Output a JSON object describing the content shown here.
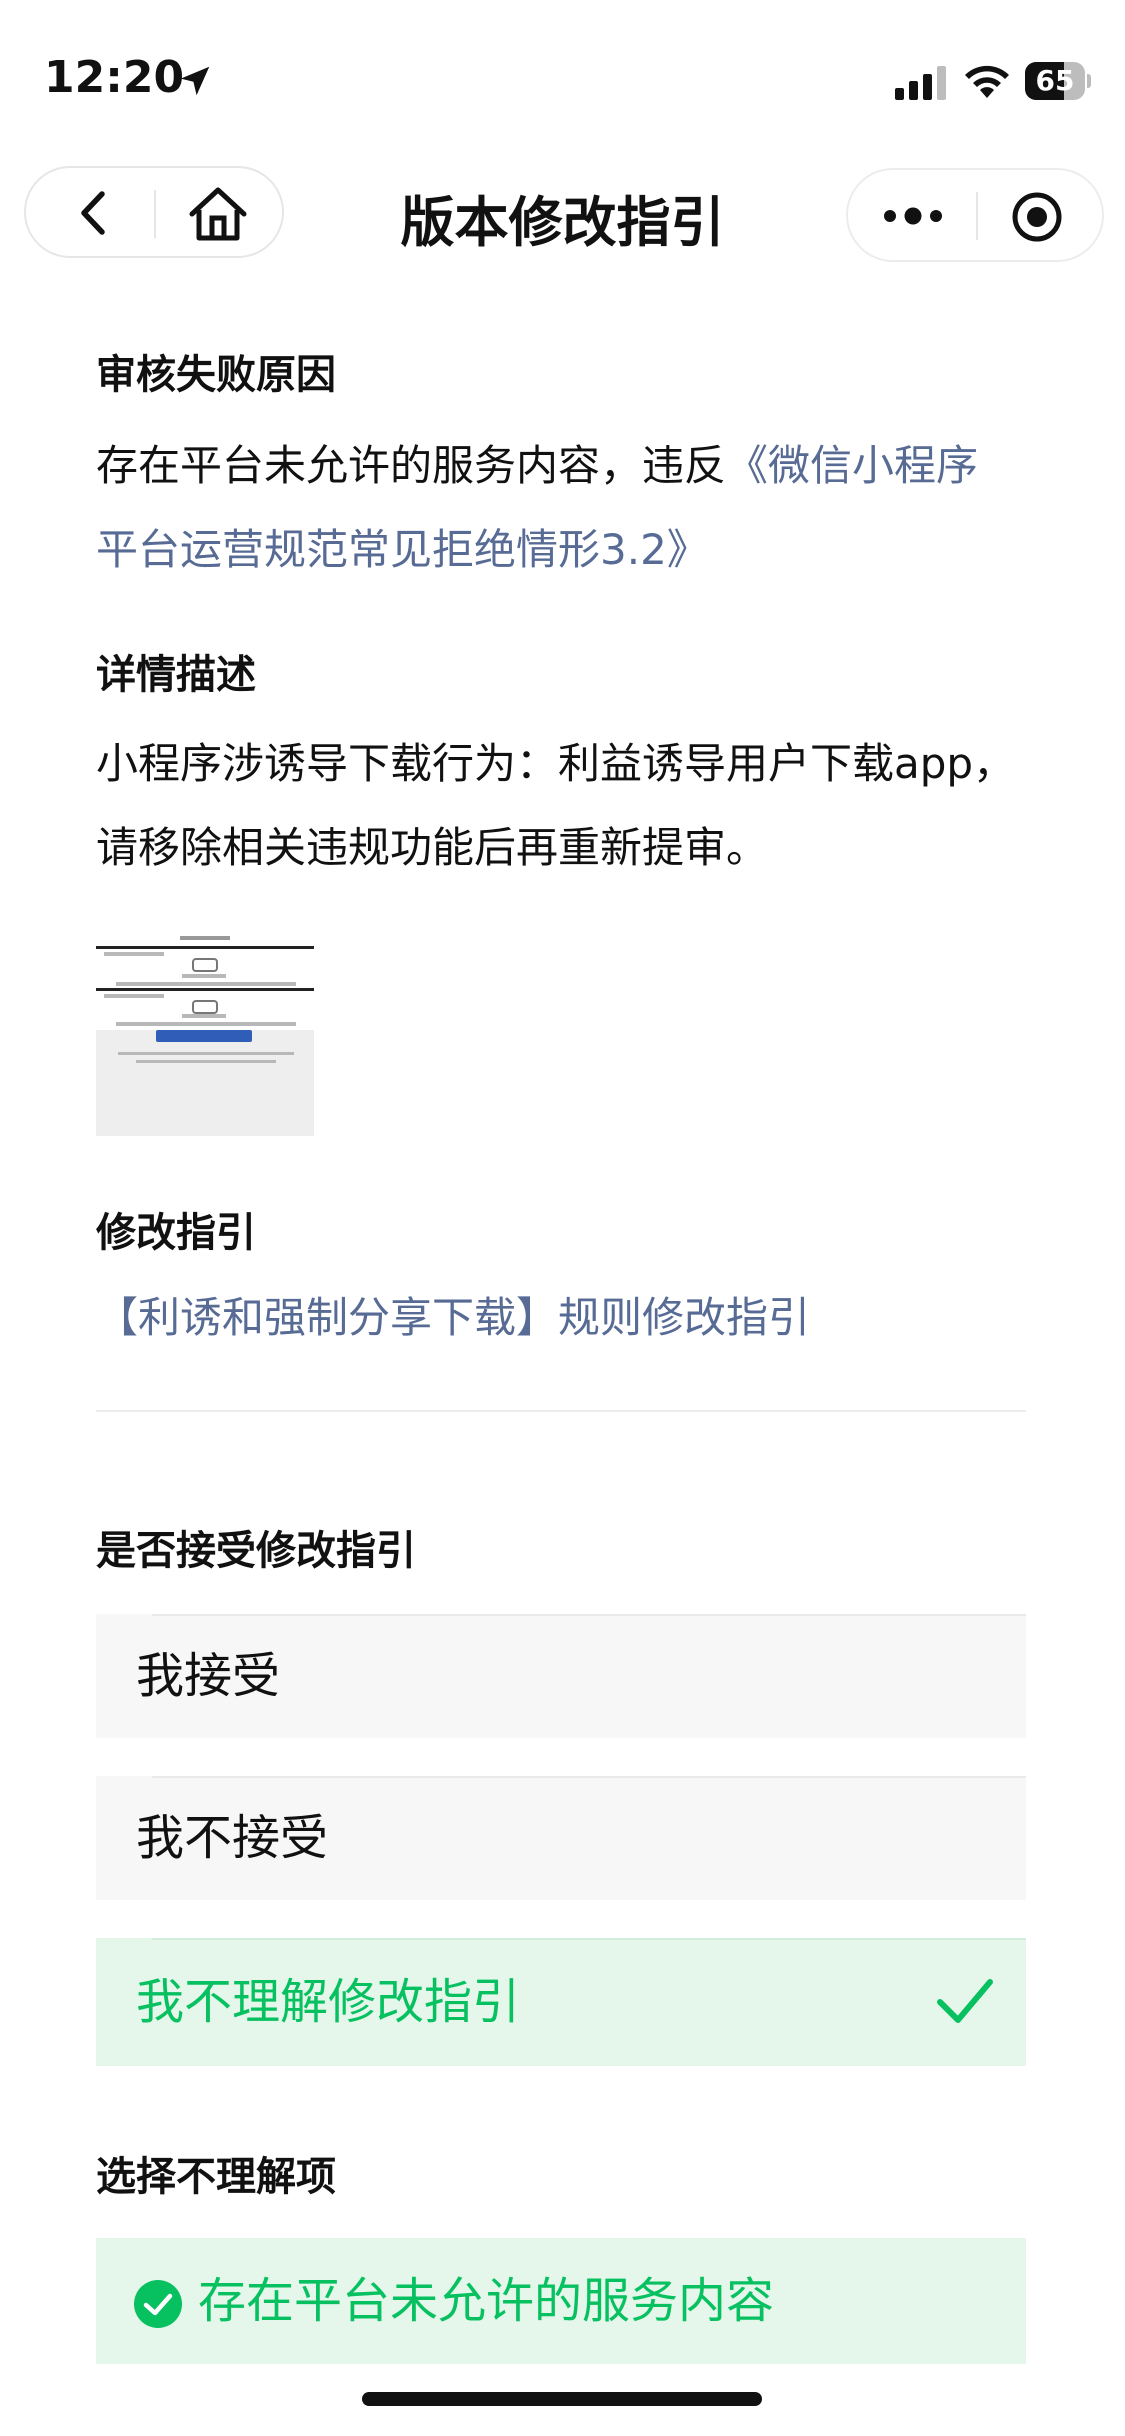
{
  "status_bar": {
    "time": "12:20",
    "battery": "65",
    "battery_level": 0.65,
    "icons": [
      "location-arrow-icon",
      "cellular-signal-icon",
      "wifi-icon",
      "battery-icon"
    ]
  },
  "nav": {
    "title": "版本修改指引",
    "left_icons": [
      "back-icon",
      "home-icon"
    ],
    "right_icons": [
      "more-icon",
      "record-icon"
    ]
  },
  "sections": {
    "reason": {
      "heading": "审核失败原因",
      "text_line1_plain": "存在平台未允许的服务内容，违反",
      "text_line1_link": "《微信小程序",
      "text_line2_link": "平台运营规范常见拒绝情形3.2》"
    },
    "detail": {
      "heading": "详情描述",
      "line1": "小程序涉诱导下载行为：利益诱导用户下载app，",
      "line2": "请移除相关违规功能后再重新提审。"
    },
    "guide": {
      "heading": "修改指引",
      "link": "【利诱和强制分享下载】规则修改指引"
    },
    "accept": {
      "heading": "是否接受修改指引",
      "options": [
        {
          "label": "我接受",
          "selected": false
        },
        {
          "label": "我不接受",
          "selected": false
        },
        {
          "label": "我不理解修改指引",
          "selected": true
        }
      ]
    },
    "not_understand": {
      "heading": "选择不理解项",
      "item": "存在平台未允许的服务内容",
      "checked": true
    }
  },
  "colors": {
    "link": "#576b95",
    "accent_green": "#07c160",
    "selected_bg": "#e5f6ea",
    "option_bg": "#f7f7f7"
  }
}
